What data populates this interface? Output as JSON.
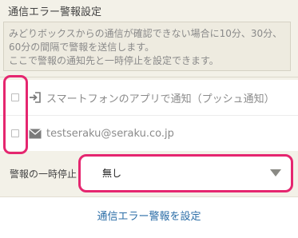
{
  "section_title": "通信エラー警報設定",
  "description": {
    "line1": "みどりボックスからの通信が確認できない場合に10分、30分、",
    "line2": "60分の間隔で警報を送信します。",
    "line3": "ここで警報の通知先と一時停止を設定できます。"
  },
  "notify_targets": [
    {
      "label": "スマートフォンのアプリで通知（プッシュ通知）",
      "icon": "sign-in-icon",
      "checked": false
    },
    {
      "label": "testseraku@seraku.co.jp",
      "icon": "envelope-icon",
      "checked": false
    }
  ],
  "pause": {
    "label": "警報の一時停止：",
    "selected": "無し"
  },
  "save_button": "通信エラー警報を設定",
  "colors": {
    "highlight": "#e5266f",
    "link": "#2c6ea7",
    "background": "#f3f1e8"
  }
}
